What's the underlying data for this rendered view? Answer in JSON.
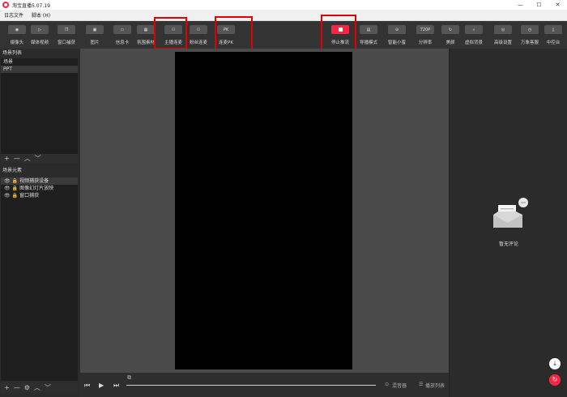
{
  "window": {
    "title": "淘宝直播5.07.19",
    "minimize": "—",
    "maximize": "☐",
    "close": "✕"
  },
  "menu": [
    "日志文件",
    "脚本 (H)"
  ],
  "toolbar": [
    {
      "label": "摄像头",
      "icon": "camera-icon",
      "glyph": "◉"
    },
    {
      "label": "媒体视频",
      "icon": "play-icon",
      "glyph": "▷"
    },
    {
      "label": "窗口捕获",
      "icon": "window-icon",
      "glyph": "❐"
    },
    {
      "label": "图片",
      "icon": "image-icon",
      "glyph": "▣"
    },
    {
      "label": "信息卡",
      "icon": "card-icon",
      "glyph": "▭"
    },
    {
      "label": "氛围素材",
      "icon": "material-icon",
      "glyph": "▦"
    },
    {
      "label": "主播连麦",
      "icon": "anchor-link-icon",
      "glyph": "⚇"
    },
    {
      "label": "粉丝连麦",
      "icon": "fan-link-icon",
      "glyph": "⚇"
    },
    {
      "label": "连麦PK",
      "icon": "pk-icon",
      "glyph": "PK"
    },
    {
      "label": "停止推流",
      "icon": "stop-icon",
      "glyph": ""
    },
    {
      "label": "导播模式",
      "icon": "director-icon",
      "glyph": "▤"
    },
    {
      "label": "智能小蜜",
      "icon": "assistant-icon",
      "glyph": "⊖"
    },
    {
      "label": "分辨率",
      "icon": "resolution-icon",
      "glyph": "720P"
    },
    {
      "label": "美颜",
      "icon": "beauty-icon",
      "glyph": "↻"
    },
    {
      "label": "虚拟背景",
      "icon": "virtual-bg-icon",
      "glyph": "⌕"
    },
    {
      "label": "高级设置",
      "icon": "settings-icon",
      "glyph": "◎"
    },
    {
      "label": "万象客服",
      "icon": "service-icon",
      "glyph": "◷"
    },
    {
      "label": "中控台",
      "icon": "console-icon",
      "glyph": "▯"
    }
  ],
  "scenes": {
    "header": "场景列表",
    "items": [
      "场景",
      "PPT"
    ]
  },
  "sources": {
    "header": "场景元素",
    "items": [
      "视频捕获设备",
      "图像幻灯片放映",
      "窗口捕获"
    ]
  },
  "controls": {
    "add": "+",
    "remove": "—",
    "up": "︿",
    "down": "﹀",
    "gear": "⚙"
  },
  "playback": {
    "prev": "⏮",
    "play": "▶",
    "next": "⏭",
    "mixer": "混音器",
    "playlist": "播放列表",
    "mixer_icon": "⊙",
    "playlist_icon": "☰",
    "cast": "⧉"
  },
  "comments": {
    "empty_text": "暂无评论",
    "download": "⤓",
    "refresh": "↻"
  },
  "colors": {
    "accent": "#ff2442",
    "highlight": "#e00000"
  }
}
